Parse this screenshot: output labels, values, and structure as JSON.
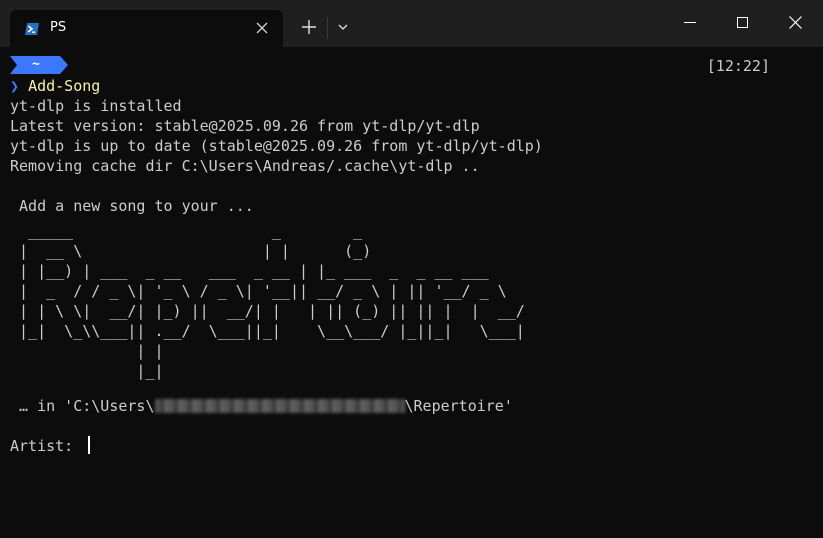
{
  "tab": {
    "title": "PS",
    "icon": "powershell-icon"
  },
  "titlebar_icons": {
    "new_tab": "plus-icon",
    "dropdown": "chevron-down-icon",
    "minimize": "minimize-icon",
    "maximize": "maximize-icon",
    "close": "close-icon"
  },
  "prompt": {
    "path": "~",
    "time": "[12:22]",
    "chevron": "❯",
    "command": "Add-Song"
  },
  "output": {
    "line1": "yt-dlp is installed",
    "line2": "Latest version: stable@2025.09.26 from yt-dlp/yt-dlp",
    "line3": "yt-dlp is up to date (stable@2025.09.26 from yt-dlp/yt-dlp)",
    "line4": "Removing cache dir C:\\Users\\Andreas/.cache\\yt-dlp ..",
    "intro": " Add a new song to your ...",
    "banner": "  _____                      _        _\n |  __ \\                    | |      (_)\n | |__) | ___  _ __   ___  _ __ | |_ ___  _  _ __ ___\n |  _  / / _ \\| '_ \\ / _ \\| '__|| __/ _ \\ | || '__/ _ \\\n | | \\ \\|  __/| |_) ||  __/| |   | || (_) || || |  |  __/\n |_|  \\_\\\\___|| .__/  \\___||_|    \\__\\___/ |_||_|   \\___|\n              | |\n              |_|",
    "path_prefix": " … in 'C:\\Users\\",
    "path_suffix": "\\Repertoire'",
    "input_label": "Artist: "
  },
  "colors": {
    "background": "#0c0c0c",
    "titlebar": "#1f1f1f",
    "prompt_blue": "#3b78ff",
    "command_yellow": "#f9f1a5",
    "text": "#cccccc"
  }
}
